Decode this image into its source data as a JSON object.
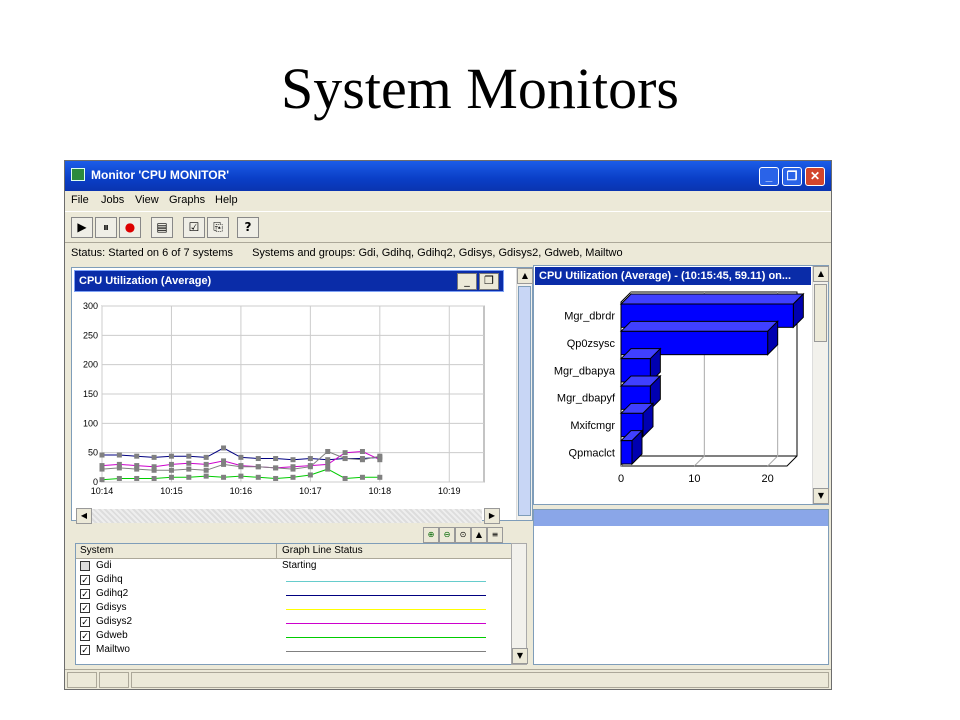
{
  "slide": {
    "title": "System Monitors"
  },
  "window": {
    "title": "Monitor 'CPU MONITOR'",
    "controls": {
      "minimize": "_",
      "restore": "❐",
      "close": "✕"
    }
  },
  "menu": [
    "File",
    "Jobs",
    "View",
    "Graphs",
    "Help"
  ],
  "toolbar": {
    "icons": [
      "start-icon",
      "pause-icon",
      "record-icon",
      "properties-icon",
      "check-icon",
      "copy-icon",
      "help-icon"
    ],
    "glyphs": [
      "▶",
      "⏸",
      "●",
      "▤",
      "☑",
      "⎘",
      "?"
    ]
  },
  "status": {
    "left": "Status: Started on 6 of 7 systems",
    "right": "Systems and groups: Gdi, Gdihq, Gdihq2, Gdisys, Gdisys2, Gdweb, Mailtwo"
  },
  "left_pane": {
    "title": "CPU Utilization (Average)",
    "controls": {
      "minimize": "_",
      "restore": "❐"
    }
  },
  "right_pane": {
    "title": "CPU Utilization (Average) - (10:15:45, 59.11) on..."
  },
  "system_list": {
    "headers": [
      "System",
      "Graph Line Status"
    ],
    "rows": [
      {
        "name": "Gdi",
        "checked": false,
        "status": "Starting",
        "color": ""
      },
      {
        "name": "Gdihq",
        "checked": true,
        "status": "",
        "color": "#66cccc"
      },
      {
        "name": "Gdihq2",
        "checked": true,
        "status": "",
        "color": "#000080"
      },
      {
        "name": "Gdisys",
        "checked": true,
        "status": "",
        "color": "#ffff00"
      },
      {
        "name": "Gdisys2",
        "checked": true,
        "status": "",
        "color": "#cc00cc"
      },
      {
        "name": "Gdweb",
        "checked": true,
        "status": "",
        "color": "#00cc00"
      },
      {
        "name": "Mailtwo",
        "checked": true,
        "status": "",
        "color": "#808080"
      }
    ]
  },
  "chart_data": [
    {
      "type": "line",
      "y_ticks": [
        "300",
        "250",
        "200",
        "150",
        "100",
        "50",
        "0"
      ],
      "x_ticks": [
        "10:14",
        "10:15",
        "10:16",
        "10:17",
        "10:18",
        "10:19"
      ],
      "ylim": [
        0,
        300
      ],
      "grid": true,
      "x": [
        "10:14:00",
        "10:14:15",
        "10:14:30",
        "10:14:45",
        "10:15:00",
        "10:15:15",
        "10:15:30",
        "10:15:45",
        "10:16:00",
        "10:16:15",
        "10:16:30",
        "10:16:45",
        "10:17:00",
        "10:17:15",
        "10:17:30",
        "10:17:45",
        "10:18:00"
      ],
      "series": [
        {
          "color": "#000080",
          "values": [
            46,
            46,
            44,
            42,
            44,
            44,
            42,
            58,
            42,
            40,
            40,
            38,
            40,
            38,
            40,
            40,
            42
          ]
        },
        {
          "color": "#cc00cc",
          "values": [
            28,
            30,
            28,
            26,
            30,
            32,
            30,
            36,
            28,
            26,
            24,
            26,
            28,
            30,
            50,
            52,
            38
          ]
        },
        {
          "color": "#00cc00",
          "values": [
            4,
            6,
            6,
            6,
            8,
            8,
            10,
            8,
            10,
            8,
            6,
            8,
            12,
            22,
            6,
            8,
            8
          ]
        },
        {
          "color": "#808080",
          "values": [
            22,
            24,
            22,
            20,
            20,
            22,
            20,
            30,
            26,
            26,
            24,
            22,
            26,
            52,
            40,
            38,
            44
          ]
        }
      ]
    },
    {
      "type": "bar",
      "categories": [
        "Mgr_dbrdr",
        "Qp0zsysc",
        "Mgr_dbapya",
        "Mgr_dbapyf",
        "Mxifcmgr",
        "Qpmaclct"
      ],
      "values": [
        23.5,
        20,
        4,
        4,
        3,
        1.5
      ],
      "x_ticks": [
        "0",
        "10",
        "20"
      ],
      "xlim": [
        0,
        24
      ],
      "color": "#0000ff"
    }
  ]
}
